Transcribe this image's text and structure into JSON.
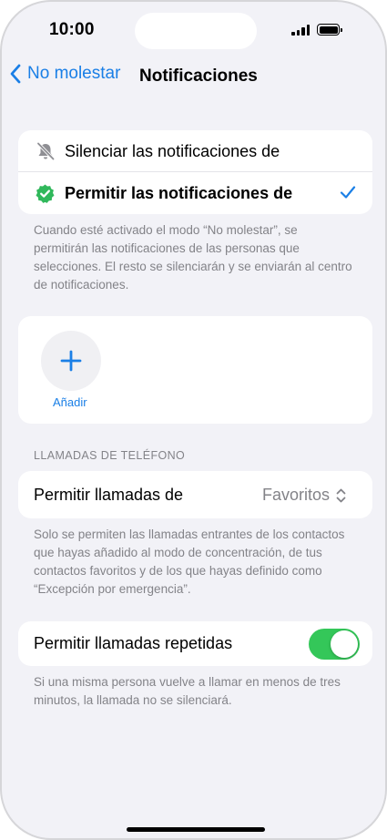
{
  "status_bar": {
    "time": "10:00"
  },
  "nav": {
    "back_label": "No molestar",
    "title": "Notificaciones"
  },
  "options": [
    {
      "label": "Silenciar las notificaciones de",
      "icon": "bell-slash-icon",
      "selected": false
    },
    {
      "label": "Permitir las notificaciones de",
      "icon": "verified-badge-icon",
      "selected": true
    }
  ],
  "options_footnote": "Cuando esté activado el modo “No molestar”, se permitirán las notificaciones de las personas que selecciones. El resto se silenciarán y se enviarán al centro de notificaciones.",
  "add": {
    "label": "Añadir",
    "icon": "plus-icon"
  },
  "calls": {
    "section_header": "LLAMADAS DE TELÉFONO",
    "allow_calls_label": "Permitir llamadas de",
    "allow_calls_value": "Favoritos",
    "allow_calls_footnote": "Solo se permiten las llamadas entrantes de los contactos que hayas añadido al modo de concentración, de tus contactos favoritos y de los que hayas definido como “Excepción por emergencia”.",
    "repeated_label": "Permitir llamadas repetidas",
    "repeated_enabled": true,
    "repeated_footnote": "Si una misma persona vuelve a llamar en menos de tres minutos, la llamada no se silenciará."
  },
  "colors": {
    "accent": "#1a7fe6",
    "toggle_on": "#34c759",
    "verified": "#30b85b",
    "background": "#f2f2f7"
  }
}
